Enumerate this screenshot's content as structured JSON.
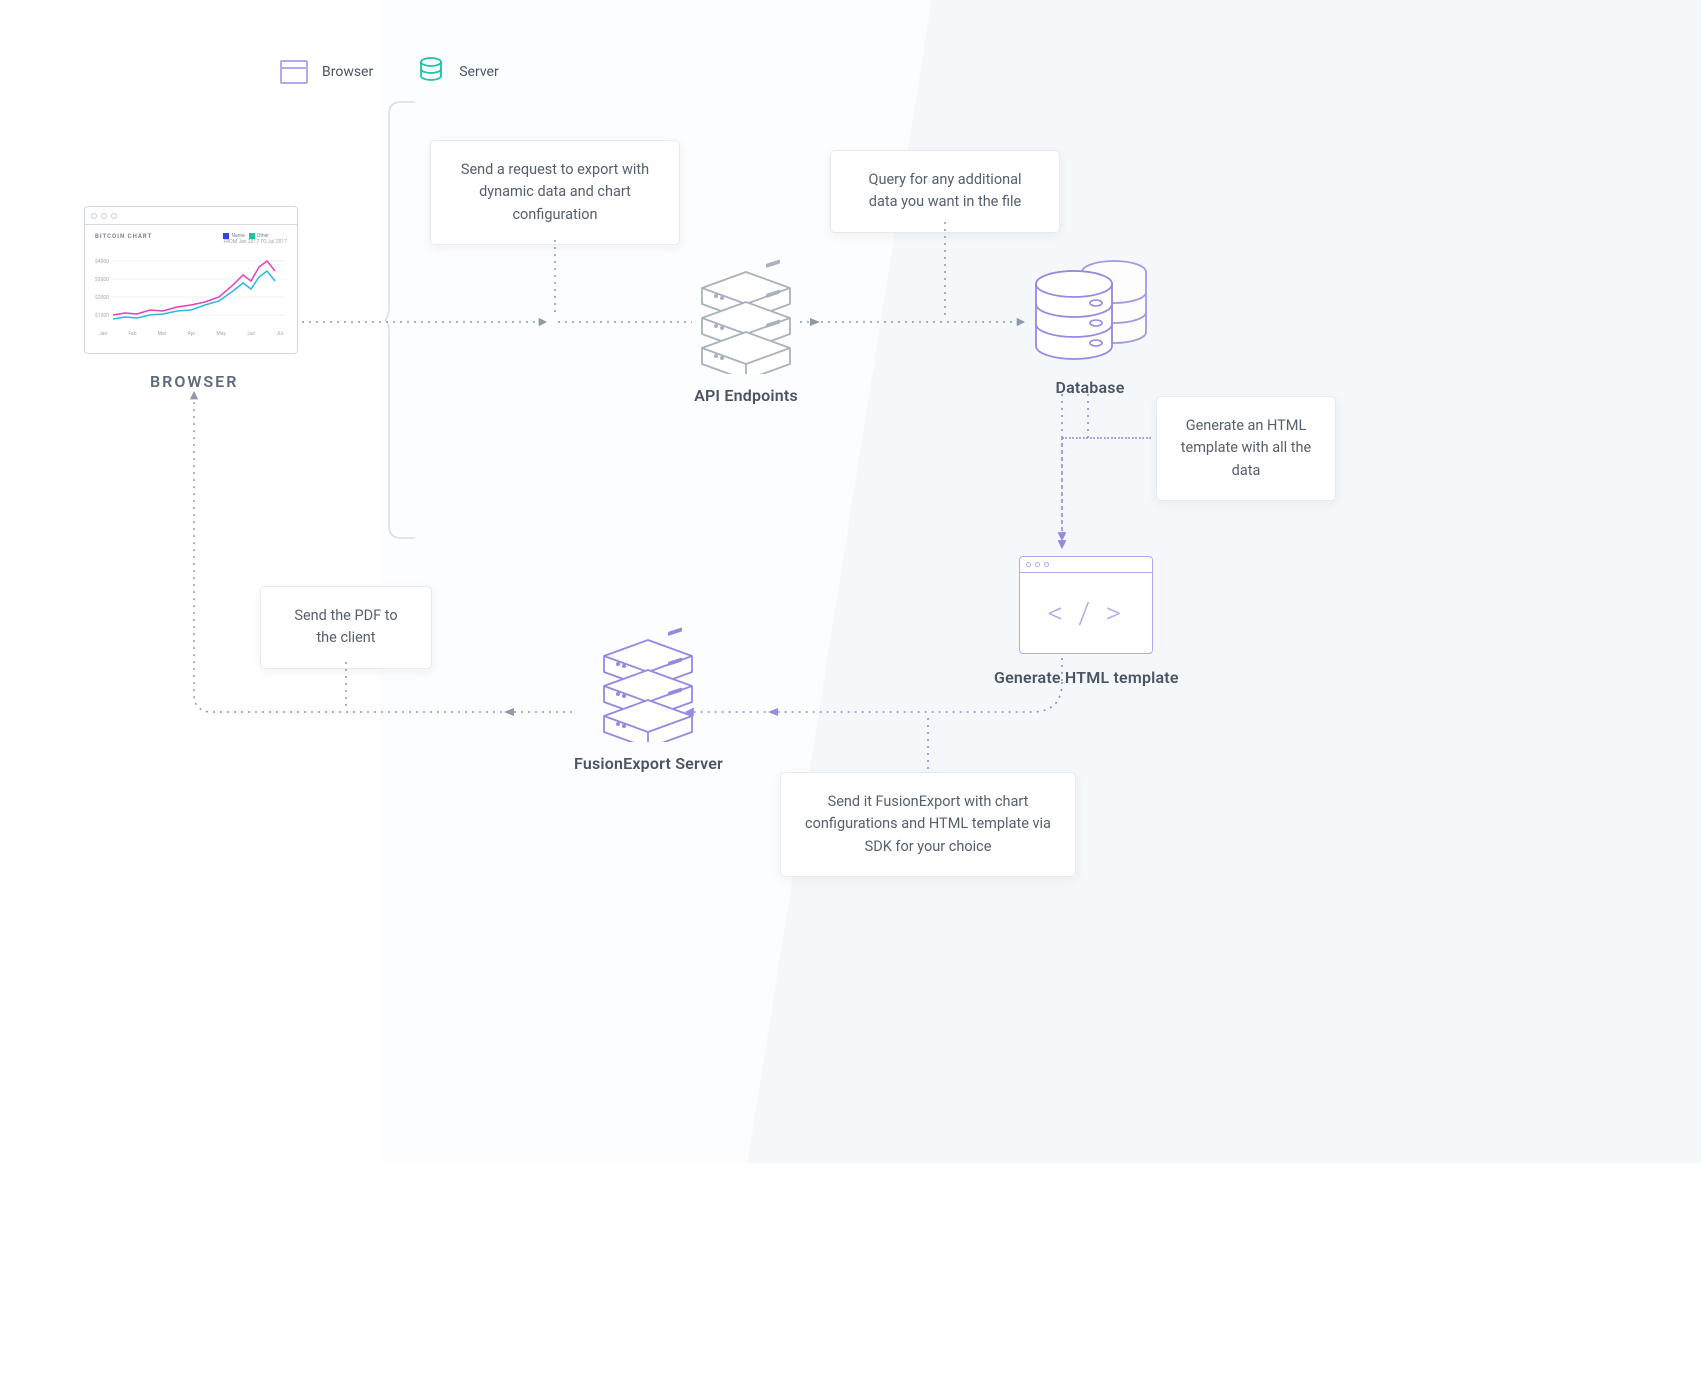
{
  "legend": {
    "browser_label": "Browser",
    "server_label": "Server"
  },
  "nodes": {
    "browser_label": "BROWSER",
    "api_label": "API Endpoints",
    "database_label": "Database",
    "html_label": "Generate HTML template",
    "fusion_label": "FusionExport Server"
  },
  "callouts": {
    "send_request": "Send a request to export with dynamic data and chart configuration",
    "query_additional": "Query for any additional data you want in the file",
    "generate_html": "Generate an HTML template with all the data",
    "send_fusion": "Send it FusionExport with chart configurations and HTML template via SDK for your choice",
    "send_pdf": "Send the PDF to the client"
  },
  "mini_chart": {
    "title": "BITCOIN CHART",
    "series_a": "Name",
    "series_b": "Other",
    "date_range": "FROM Jan 2017 TO Jul 2017",
    "y_ticks": [
      "$4000",
      "$3000",
      "$2000",
      "$1000"
    ],
    "x_ticks": [
      "Jan",
      "Feb",
      "Mar",
      "Apr",
      "May",
      "Jun",
      "Jul"
    ]
  },
  "html_mock_code": "< / >",
  "colors": {
    "purple": "#9788e0",
    "gray_stroke": "#a9b2bc",
    "text": "#4a5464",
    "teal": "#18c6a1"
  }
}
